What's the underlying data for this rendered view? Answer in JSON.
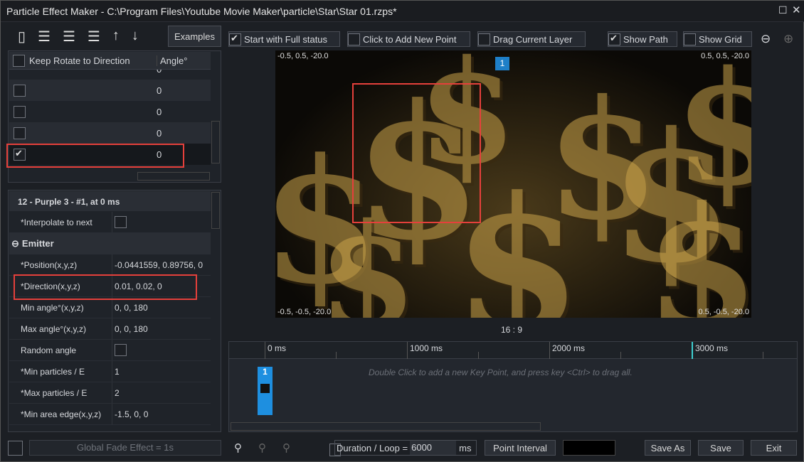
{
  "window": {
    "title": "Particle Effect Maker - C:\\Program Files\\Youtube Movie Maker\\particle\\Star\\Star 01.rzps*"
  },
  "toolbar": {
    "examples": "Examples",
    "icons": [
      "open-icon",
      "add-layer-icon",
      "delete-layer-icon",
      "delete-all-layers-icon",
      "move-up-icon",
      "move-down-icon"
    ]
  },
  "options": [
    {
      "label": "Start with Full status",
      "checked": true
    },
    {
      "label": "Click to Add New Point",
      "checked": false
    },
    {
      "label": "Drag Current Layer",
      "checked": false
    },
    {
      "label": "Show Path",
      "checked": true
    },
    {
      "label": "Show Grid",
      "checked": false
    }
  ],
  "layers": {
    "col1": "Keep Rotate to Direction",
    "col2": "Angle°",
    "rows": [
      {
        "checked": false,
        "angle": "0"
      },
      {
        "checked": false,
        "angle": "0"
      },
      {
        "checked": false,
        "angle": "0"
      },
      {
        "checked": false,
        "angle": "0"
      },
      {
        "checked": true,
        "angle": "0"
      }
    ]
  },
  "props": {
    "header": "12 - Purple 3 - #1, at 0 ms",
    "interpolate": "*Interpolate to next",
    "section": "Emitter",
    "rows": [
      {
        "k": "*Position(x,y,z)",
        "v": "-0.0441559, 0.89756, 0"
      },
      {
        "k": "*Direction(x,y,z)",
        "v": "0.01, 0.02, 0"
      },
      {
        "k": "Min angle°(x,y,z)",
        "v": "0, 0, 180"
      },
      {
        "k": "Max angle°(x,y,z)",
        "v": "0, 0, 180"
      },
      {
        "k": "Random angle",
        "v": ""
      },
      {
        "k": "*Min particles / E",
        "v": "1"
      },
      {
        "k": "*Max particles / E",
        "v": "2"
      },
      {
        "k": "*Min area edge(x,y,z)",
        "v": "-1.5, 0, 0"
      }
    ]
  },
  "preview": {
    "tl": "-0.5, 0.5, -20.0",
    "tr": "0.5, 0.5, -20.0",
    "bl": "-0.5, -0.5, -20.0",
    "br": "0.5, -0.5, -20.0",
    "marker": "1",
    "aspect": "16 : 9"
  },
  "timeline": {
    "ticks": [
      "0 ms",
      "1000 ms",
      "2000 ms",
      "3000 ms"
    ],
    "hint": "Double Click to add a new Key Point, and press key <Ctrl> to drag all.",
    "key": "1"
  },
  "bottom": {
    "fade": "Global Fade Effect = 1s",
    "duration_label": "Duration / Loop =",
    "duration": "6000",
    "unit": "ms",
    "point_interval": "Point Interval",
    "save_as": "Save As",
    "save": "Save",
    "exit": "Exit"
  }
}
